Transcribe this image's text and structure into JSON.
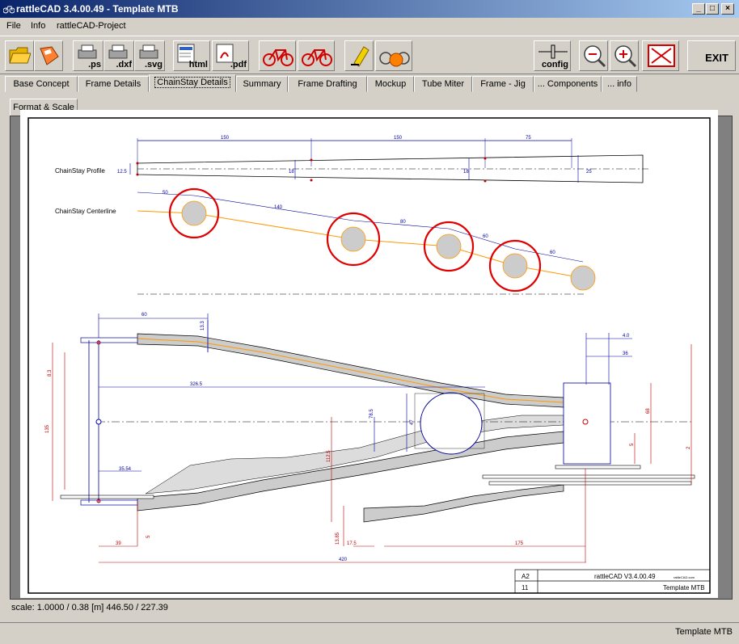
{
  "window": {
    "title": "rattleCAD  3.4.00.49 - Template MTB"
  },
  "menu": [
    "File",
    "Info",
    "rattleCAD-Project"
  ],
  "toolbar": {
    "ps": ".ps",
    "dxf": ".dxf",
    "svg": ".svg",
    "html": "html",
    "pdf": ".pdf",
    "config": "config",
    "exit": "EXIT"
  },
  "tabs": [
    "Base Concept",
    "Frame Details",
    "ChainStay Details",
    "Summary",
    "Frame Drafting",
    "Mockup",
    "Tube Miter",
    "Frame - Jig",
    "... Components",
    "... info"
  ],
  "active_tab": "ChainStay Details",
  "subtab": "Format & Scale",
  "drawing": {
    "profile_label": "ChainStay Profile",
    "centerline_label": "ChainStay Centerline",
    "dim_150a": "150",
    "dim_150b": "150",
    "dim_75": "75",
    "dim_12_5": "12.5",
    "dim_18a": "18",
    "dim_18b": "18",
    "dim_25": "25",
    "dim_50": "50",
    "dim_140": "140",
    "dim_80": "80",
    "dim_60a": "60",
    "dim_60b": "60",
    "dim_60top": "60",
    "dim_133": "13.3",
    "dim_4": "4.0",
    "dim_36": "36",
    "dim_3265": "326.5",
    "dim_785": "78.5",
    "dim_47": "47",
    "dim_68": "68",
    "dim_1125": "112.5",
    "dim_135": "135",
    "dim_2": "2",
    "dim_3554": "35.54",
    "dim_39": "39",
    "dim_5a": "5",
    "dim_5b": "5",
    "dim_1385": "13.85",
    "dim_175": "17.5",
    "dim_175b": "175",
    "dim_420": "420",
    "dim_83": "8.3",
    "tb_a2": "A2",
    "tb_app": "rattleCAD  V3.4.00.49",
    "tb_11": "11",
    "tb_name": "Template MTB",
    "tb_logo": "rattleCAD.com"
  },
  "status": {
    "scale": "scale: 1.0000 / 0.38  [m]  446.50 / 227.39",
    "right": "Template MTB"
  },
  "colors": {
    "dim_blue": "#0000a0",
    "dim_red": "#c00000",
    "highlight_red": "#e00000",
    "centerline_orange": "#ff9900",
    "tube_gray": "#cccccc"
  }
}
